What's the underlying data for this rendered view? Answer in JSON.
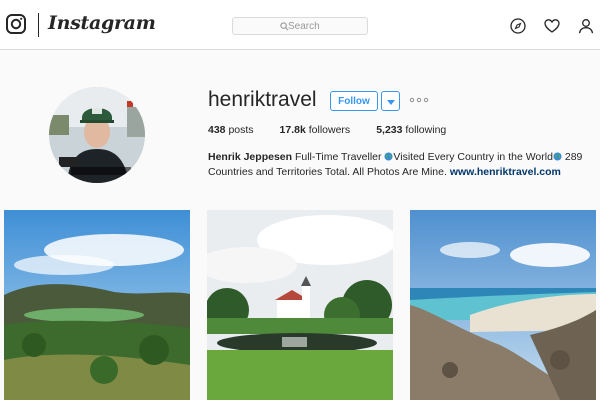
{
  "header": {
    "wordmark": "Instagram",
    "search_placeholder": "Search",
    "icons": [
      "instagram-glyph-icon",
      "compass-icon",
      "heart-icon",
      "person-icon"
    ]
  },
  "profile": {
    "username": "henriktravel",
    "follow_label": "Follow",
    "stats": [
      {
        "value": "438",
        "label": " posts"
      },
      {
        "value": "17.8k",
        "label": " followers"
      },
      {
        "value": "5,233",
        "label": " following"
      }
    ],
    "bio": {
      "name": "Henrik Jeppesen",
      "text1": " Full-Time Traveller ",
      "text2": "Visited Every Country in the World",
      "text3": " 289 Countries and Territories Total. All Photos Are Mine. ",
      "link": "www.henriktravel.com"
    }
  },
  "posts": [
    {
      "subject": "crater lake landscape"
    },
    {
      "subject": "white church by a pond"
    },
    {
      "subject": "coastal beach lagoon"
    }
  ],
  "colors": {
    "accent": "#3897f0",
    "link": "#003569",
    "border": "#dbdbdb",
    "background": "#fafafa"
  }
}
